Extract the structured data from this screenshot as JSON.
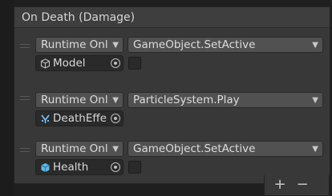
{
  "event": {
    "title": "On Death (Damage)"
  },
  "listeners": [
    {
      "runtime": "Runtime Onl",
      "method": "GameObject.SetActive",
      "object": "Model",
      "object_icon": "gameobject-icon",
      "has_checkbox": true
    },
    {
      "runtime": "Runtime Onl",
      "method": "ParticleSystem.Play",
      "object": "DeathEffe",
      "object_icon": "particle-system-icon",
      "has_checkbox": false
    },
    {
      "runtime": "Runtime Onl",
      "method": "GameObject.SetActive",
      "object": "Health",
      "object_icon": "prefab-icon",
      "has_checkbox": true
    }
  ],
  "footer": {
    "add_label": "+",
    "remove_label": "−"
  },
  "colors": {
    "background": "#1f1f1f",
    "panel": "#383838",
    "header": "#3e3e3e",
    "dropdown": "#515151",
    "field": "#2a2a2a",
    "prefab_blue": "#5fb8e8",
    "particle_blue": "#7fc4ff"
  }
}
